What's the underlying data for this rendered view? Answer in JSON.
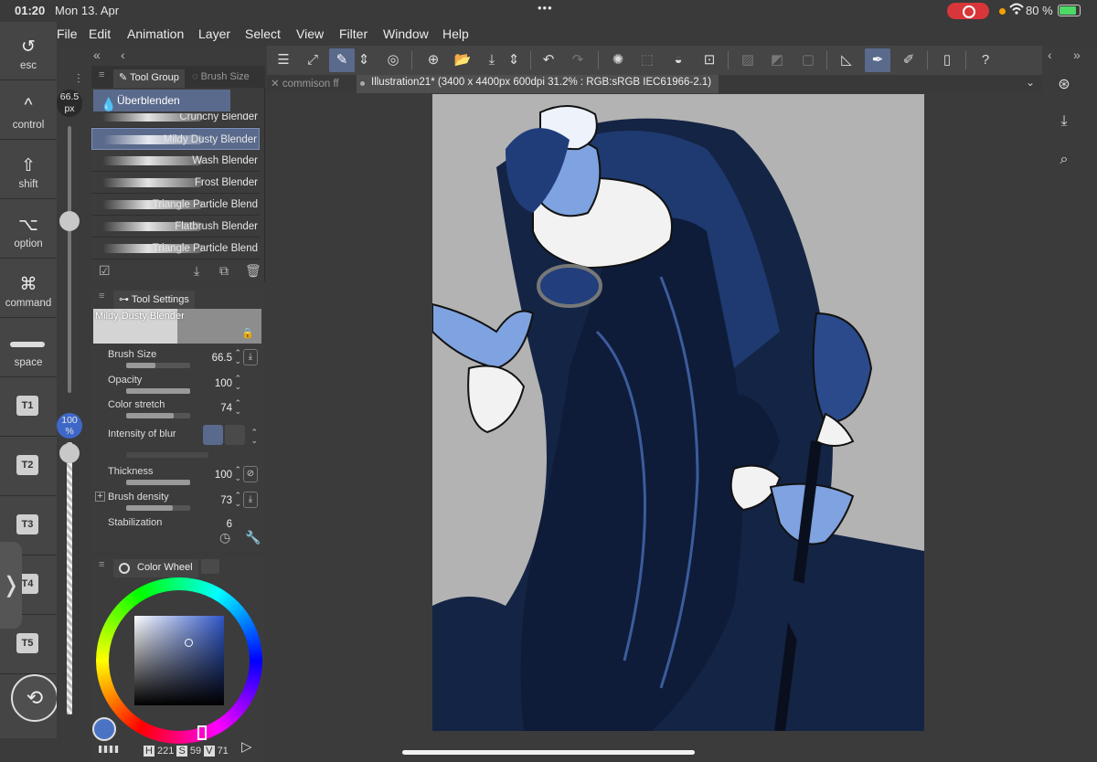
{
  "status": {
    "time": "01:20",
    "date": "Mon 13. Apr",
    "battery": "80 %"
  },
  "menu": [
    "File",
    "Edit",
    "Animation",
    "Layer",
    "Select",
    "View",
    "Filter",
    "Window",
    "Help"
  ],
  "shortcuts": [
    {
      "icon": "esc-icon",
      "label": "esc"
    },
    {
      "icon": "control-icon",
      "label": "control"
    },
    {
      "icon": "shift-icon",
      "label": "shift"
    },
    {
      "icon": "option-icon",
      "label": "option"
    },
    {
      "icon": "command-icon",
      "label": "command"
    },
    {
      "icon": "space-icon",
      "label": "space"
    }
  ],
  "tkeys": [
    "T1",
    "T2",
    "T3",
    "T4",
    "T5"
  ],
  "sliders": {
    "size": "66.5",
    "size_unit": "px",
    "opacity": "100",
    "opacity_unit": "%",
    "size_fraction": 0.35,
    "opacity_fraction": 1.0
  },
  "tool_group": {
    "tab_active": "Tool Group",
    "tab_inactive": "Brush Size",
    "group": "Überblenden",
    "brushes": [
      "Crunchy Blender",
      "Mildy Dusty Blender",
      "Wash Blender",
      "Frost Blender",
      "Triangle Particle Blend",
      "Flatbrush Blender",
      "Triangle Particle Blend"
    ],
    "selected_index": 1
  },
  "tool_settings": {
    "tab": "Tool Settings",
    "brush_name": "Mildy Dusty Blender",
    "props": [
      {
        "label": "Brush Size",
        "value": "66.5",
        "level": 0.45
      },
      {
        "label": "Opacity",
        "value": "100",
        "level": 1.0
      },
      {
        "label": "Color stretch",
        "value": "74",
        "level": 0.74
      },
      {
        "label": "Intensity of blur",
        "value": "",
        "level": 0
      },
      {
        "label": "Thickness",
        "value": "100",
        "level": 1.0
      },
      {
        "label": "Brush density",
        "value": "73",
        "level": 0.73
      },
      {
        "label": "Stabilization",
        "value": "6",
        "level": 0.06
      }
    ]
  },
  "color_panel": {
    "tab": "Color Wheel",
    "h_label": "H",
    "h": "221",
    "s_label": "S",
    "s": "59",
    "v_label": "V",
    "v": "71",
    "current_color": "#4a73c4"
  },
  "doc_tabs": {
    "inactive": "commison ff",
    "active": "Illustration21* (3400 x 4400px 600dpi 31.2% : RGB:sRGB IEC61966-2.1)"
  },
  "toolbar_icons": [
    "menu-icon",
    "fit-icon",
    "edit-tool-icon",
    "stepper-icon",
    "swirl-icon",
    "new-canvas-icon",
    "open-icon",
    "save-icon",
    "stepper-icon",
    "undo-icon",
    "redo-icon",
    "loading-icon",
    "deselect-icon",
    "fill-icon",
    "transform-icon",
    "grid-icon",
    "gradient-icon",
    "frame-icon",
    "ruler-icon",
    "pen-active-icon",
    "pencil-icon",
    "device-icon",
    "help-icon"
  ],
  "accent": "#5a6a8c"
}
